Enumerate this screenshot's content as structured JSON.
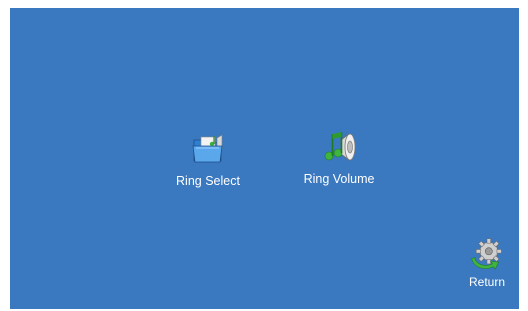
{
  "menu": {
    "items": [
      {
        "label": "Ring Select",
        "icon": "folder-music-icon"
      },
      {
        "label": "Ring Volume",
        "icon": "speaker-music-note-icon"
      }
    ]
  },
  "footer": {
    "return_label": "Return",
    "return_icon": "gear-arrow-icon"
  },
  "colors": {
    "background": "#3a78bf",
    "text": "#ffffff"
  }
}
